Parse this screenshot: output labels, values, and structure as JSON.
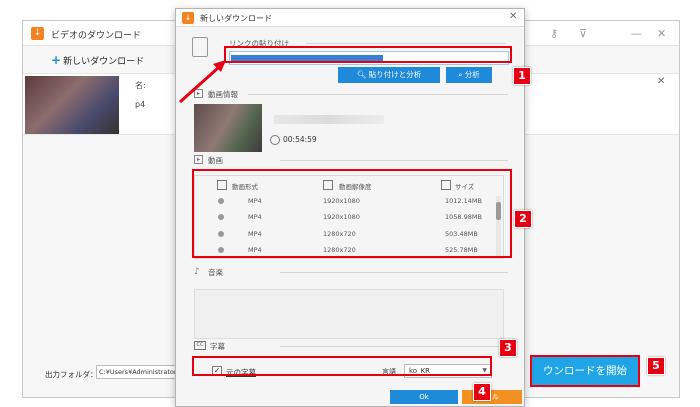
{
  "background_window": {
    "title": "ビデオのダウンロード",
    "new_download_label": "新しいダウンロード",
    "item_filename_partial": "名:",
    "item_format_partial": "p4",
    "output_folder_label": "出力フォルダ：",
    "output_folder_path": "C:¥Users¥Administrator¥Vide",
    "start_download_button": "ウンロードを開始"
  },
  "dialog": {
    "title": "新しいダウンロード",
    "link_section_label": "リンクの貼り付け",
    "paste_analyze_button": "貼り付けと分析",
    "analyze_button": "分析",
    "video_info_label": "動画情報",
    "duration": "00:54:59",
    "video_section_label": "動画",
    "table_headers": {
      "format": "動画形式",
      "resolution": "動画解像度",
      "size": "サイズ"
    },
    "video_rows": [
      {
        "format": "MP4",
        "resolution": "1920x1080",
        "size": "1012.14MB"
      },
      {
        "format": "MP4",
        "resolution": "1920x1080",
        "size": "1058.98MB"
      },
      {
        "format": "MP4",
        "resolution": "1280x720",
        "size": "503.48MB"
      },
      {
        "format": "MP4",
        "resolution": "1280x720",
        "size": "525.78MB"
      }
    ],
    "audio_section_label": "音楽",
    "subtitle_section_label": "字幕",
    "subtitle_checkbox_label": "元の字幕",
    "language_label": "言語",
    "language_value": "ko_KR",
    "ok_button": "Ok",
    "cancel_button": "セル"
  },
  "annotations": {
    "badges": [
      "1",
      "2",
      "3",
      "4",
      "5"
    ],
    "color": "#e60012"
  },
  "colors": {
    "accent_blue": "#1f8ad9",
    "start_blue": "#1fa4e6",
    "brand_orange": "#f58220",
    "cancel_orange": "#f29022"
  }
}
